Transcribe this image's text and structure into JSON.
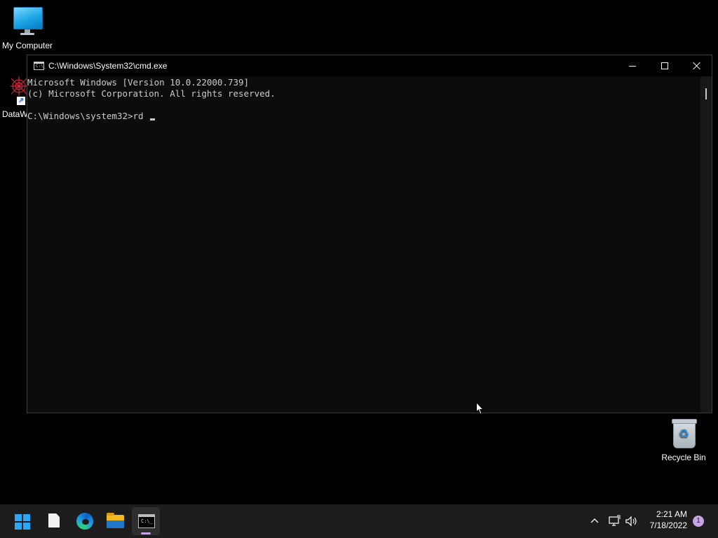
{
  "desktop": {
    "icons": {
      "my_computer": {
        "label": "My Computer",
        "icon": "monitor-icon"
      },
      "dataw": {
        "label": "DataW",
        "icon": "app-shortcut-icon"
      },
      "recycle_bin": {
        "label": "Recycle Bin",
        "icon": "recycle-bin-icon"
      }
    }
  },
  "cmd_window": {
    "title": "C:\\Windows\\System32\\cmd.exe",
    "icon": "cmd-icon",
    "icon_text": "C:\\_",
    "console_lines": [
      "Microsoft Windows [Version 10.0.22000.739]",
      "(c) Microsoft Corporation. All rights reserved.",
      "C:\\Windows\\system32>rd "
    ],
    "controls": [
      "minimize-icon",
      "maximize-icon",
      "close-icon"
    ]
  },
  "taskbar": {
    "apps": [
      {
        "name": "Start",
        "icon": "windows-start-icon"
      },
      {
        "name": "File",
        "icon": "file-icon"
      },
      {
        "name": "Microsoft Edge",
        "icon": "edge-icon"
      },
      {
        "name": "File Explorer",
        "icon": "folder-icon"
      },
      {
        "name": "Command Prompt",
        "icon": "cmd-icon",
        "active": true
      }
    ],
    "cmd_icon_text": "C:\\_",
    "tray": {
      "icons": [
        "chevron-up-icon",
        "network-icon",
        "volume-icon"
      ],
      "time": "2:21 AM",
      "date": "7/18/2022",
      "notifications": "1"
    }
  },
  "colors": {
    "desktop_bg": "#000000",
    "console_bg": "#0c0c0c",
    "console_text": "#cccccc",
    "taskbar_bg": "#1c1c1c",
    "accent": "#c7a4e8",
    "start_blue": "#2da7f5"
  }
}
